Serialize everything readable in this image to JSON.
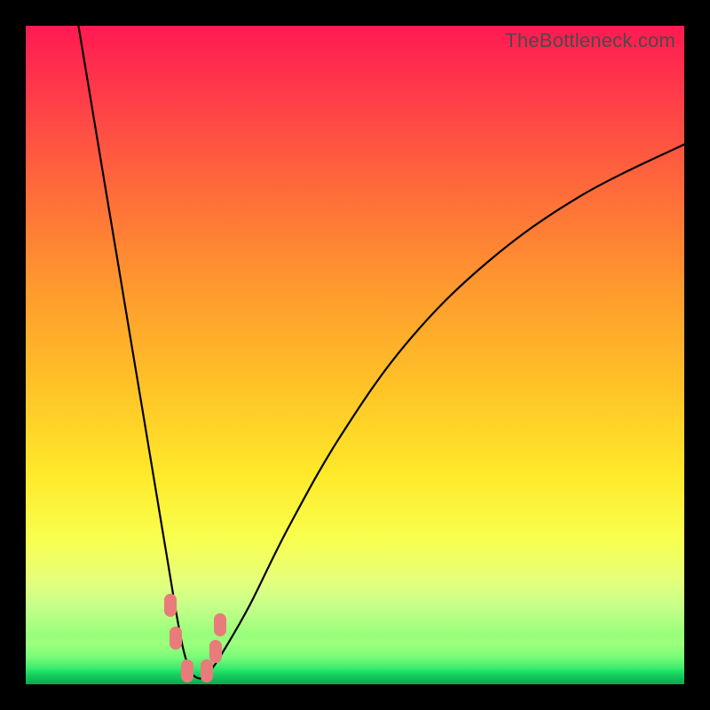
{
  "watermark": "TheBottleneck.com",
  "chart_data": {
    "type": "line",
    "title": "",
    "xlabel": "",
    "ylabel": "",
    "xlim": [
      0,
      100
    ],
    "ylim": [
      0,
      100
    ],
    "series": [
      {
        "name": "bottleneck-curve",
        "x": [
          8,
          10,
          12,
          14,
          16,
          18,
          20,
          21,
          22,
          23,
          24,
          25,
          26,
          27,
          28,
          30,
          34,
          40,
          48,
          58,
          70,
          84,
          100
        ],
        "y": [
          100,
          88,
          76,
          64,
          52,
          40,
          28,
          22,
          16,
          10,
          5,
          2,
          1,
          1,
          2,
          5,
          12,
          24,
          38,
          52,
          64,
          74,
          82
        ]
      }
    ],
    "markers": [
      {
        "name": "marker-left-upper",
        "x": 22.0,
        "y": 12
      },
      {
        "name": "marker-left-lower",
        "x": 22.8,
        "y": 7
      },
      {
        "name": "marker-trough-left",
        "x": 24.5,
        "y": 2
      },
      {
        "name": "marker-trough-right",
        "x": 27.5,
        "y": 2
      },
      {
        "name": "marker-right-upper",
        "x": 29.5,
        "y": 9
      },
      {
        "name": "marker-right-lower",
        "x": 28.8,
        "y": 5
      }
    ],
    "gradient_note": "background encodes bottleneck severity: red (high) at top through yellow to green (low) at bottom"
  }
}
